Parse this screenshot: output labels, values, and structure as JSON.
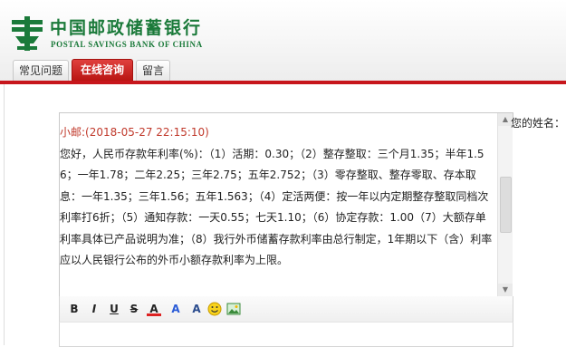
{
  "bank": {
    "name_cn": "中国邮政储蓄银行",
    "name_en": "POSTAL SAVINGS BANK OF CHINA"
  },
  "tabs": [
    {
      "label": "常见问题",
      "active": false
    },
    {
      "label": "在线咨询",
      "active": true
    },
    {
      "label": "留言",
      "active": false
    }
  ],
  "chat": {
    "sender": "小邮:",
    "timestamp": "(2018-05-27 22:15:10)",
    "message": "您好，人民币存款年利率(%)：（1）活期：0.30；（2）整存整取：三个月1.35；半年1.56；一年1.78；二年2.25；三年2.75；五年2.752；（3）零存整取、整存零取、存本取息：一年1.35；三年1.56；五年1.563；（4）定活两便：按一年以内定期整存整取同档次利率打6折；（5）通知存款：一天0.55；七天1.10；（6）协定存款：1.00（7）大额存单利率具体已产品说明为准；（8）我行外币储蓄存款利率由总行制定，1年期以下（含）利率应以人民银行公布的外币小额存款利率为上限。"
  },
  "form": {
    "name_label": "您的姓名："
  },
  "colors": {
    "brand_green": "#1b7a3a",
    "brand_red": "#c7161c",
    "sender_red": "#c0392b"
  },
  "toolbar": {
    "bold": "B",
    "italic": "I",
    "underline": "U",
    "strike": "S",
    "font_color": "A",
    "highlight": "A",
    "font_size": "A",
    "icons": [
      "bold-icon",
      "italic-icon",
      "underline-icon",
      "strikethrough-icon",
      "font-color-icon",
      "highlight-icon",
      "font-size-icon",
      "emoji-icon",
      "image-icon"
    ]
  }
}
